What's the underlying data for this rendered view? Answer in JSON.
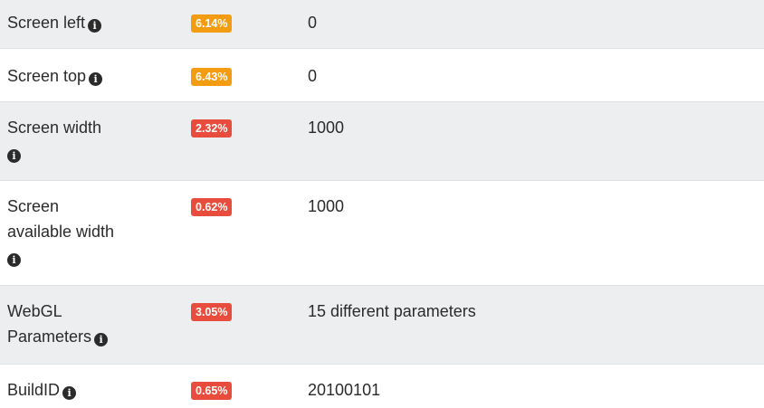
{
  "rows": [
    {
      "label": "Screen left",
      "badge": "6.14%",
      "badge_level": "warning",
      "value": "0"
    },
    {
      "label": "Screen top",
      "badge": "6.43%",
      "badge_level": "warning",
      "value": "0"
    },
    {
      "label": "Screen width",
      "badge": "2.32%",
      "badge_level": "danger",
      "value": "1000"
    },
    {
      "label_lines": [
        "Screen",
        "available width"
      ],
      "badge": "0.62%",
      "badge_level": "danger",
      "value": "1000"
    },
    {
      "label_lines": [
        "WebGL",
        "Parameters"
      ],
      "badge": "3.05%",
      "badge_level": "danger",
      "value": "15 different parameters"
    },
    {
      "label": "BuildID",
      "badge": "0.65%",
      "badge_level": "danger",
      "value": "20100101"
    }
  ],
  "icons": {
    "info": "info-circle-icon",
    "info_glyph": "i"
  },
  "colors": {
    "warning": "#f39c12",
    "danger": "#e74c3c",
    "row_shade": "#eceef0",
    "text": "#2b2b2b"
  }
}
